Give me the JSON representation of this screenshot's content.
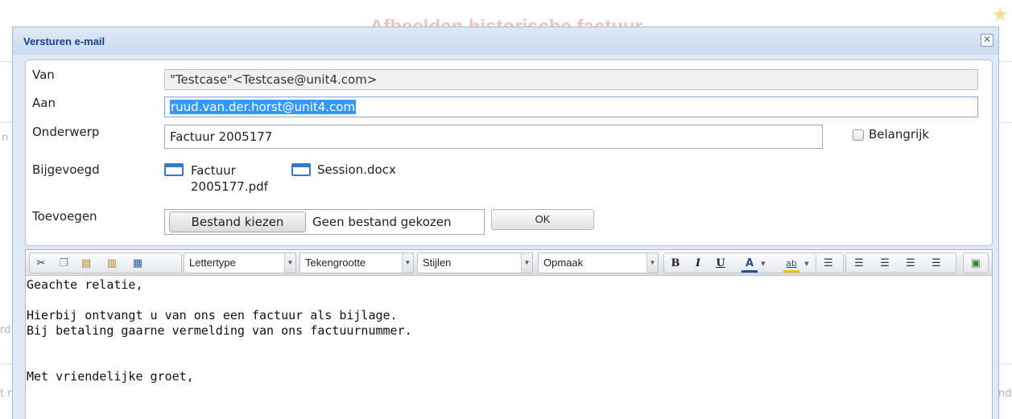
{
  "background": {
    "page_title": "Afbeelden historische factuur",
    "frag_left_1": "n",
    "frag_left_2": "rd",
    "frag_left_3": "t r",
    "frag_right_1": "nd"
  },
  "dialog": {
    "title": "Versturen e-mail",
    "close_icon": "close-icon"
  },
  "form": {
    "van_label": "Van",
    "van_value": "\"Testcase\"<Testcase@unit4.com>",
    "aan_label": "Aan",
    "aan_value": "ruud.van.der.horst@unit4.com",
    "onderwerp_label": "Onderwerp",
    "onderwerp_value": "Factuur 2005177",
    "belangrijk_label": "Belangrijk",
    "bijgevoegd_label": "Bijgevoegd",
    "attachments": [
      {
        "name_line1": "Factuur",
        "name_line2": "2005177.pdf"
      },
      {
        "name_line1": "Session.docx"
      }
    ],
    "toevoegen_label": "Toevoegen",
    "choose_file_label": "Bestand kiezen",
    "no_file_label": "Geen bestand gekozen",
    "ok_label": "OK"
  },
  "editor": {
    "toolbar": {
      "font_combo": "Lettertype",
      "size_combo": "Tekengrootte",
      "styles_combo": "Stijlen",
      "format_combo": "Opmaak",
      "bold": "B",
      "italic": "I",
      "underline": "U",
      "text_color": "A",
      "highlight": "ab"
    },
    "body_lines": [
      "Geachte relatie,",
      "",
      "Hierbij ontvangt u van ons een factuur als bijlage.",
      "Bij betaling gaarne vermelding van ons factuurnummer.",
      "",
      "",
      "Met vriendelijke groet,"
    ]
  }
}
